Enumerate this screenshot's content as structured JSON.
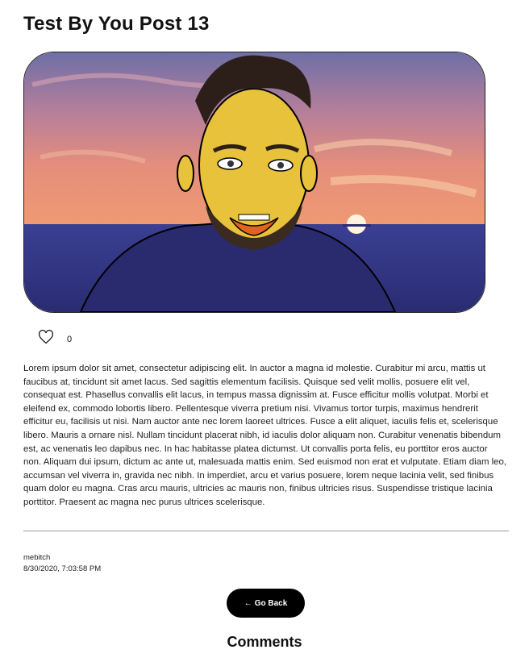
{
  "post": {
    "title": "Test By You Post 13",
    "image_alt": "Cartoon man with beard in front of a sunset over the sea",
    "like_count": "0",
    "body": "Lorem ipsum dolor sit amet, consectetur adipiscing elit. In auctor a magna id molestie. Curabitur mi arcu, mattis ut faucibus at, tincidunt sit amet lacus. Sed sagittis elementum facilisis. Quisque sed velit mollis, posuere elit vel, consequat est. Phasellus convallis elit lacus, in tempus massa dignissim at. Fusce efficitur mollis volutpat. Morbi et eleifend ex, commodo lobortis libero. Pellentesque viverra pretium nisi. Vivamus tortor turpis, maximus hendrerit efficitur eu, facilisis ut nisi. Nam auctor ante nec lorem laoreet ultrices. Fusce a elit aliquet, iaculis felis et, scelerisque libero. Mauris a ornare nisl. Nullam tincidunt placerat nibh, id iaculis dolor aliquam non. Curabitur venenatis bibendum est, ac venenatis leo dapibus nec. In hac habitasse platea dictumst. Ut convallis porta felis, eu porttitor eros auctor non. Aliquam dui ipsum, dictum ac ante ut, malesuada mattis enim. Sed euismod non erat et vulputate. Etiam diam leo, accumsan vel viverra in, gravida nec nibh. In imperdiet, arcu et varius posuere, lorem neque lacinia velit, sed finibus quam dolor eu magna. Cras arcu mauris, ultricies ac mauris non, finibus ultricies risus. Suspendisse tristique lacinia porttitor. Praesent ac magna nec purus ultrices scelerisque.",
    "author": "mebitch",
    "timestamp": "8/30/2020, 7:03:58 PM"
  },
  "actions": {
    "back_arrow": "←",
    "back_label": "Go Back"
  },
  "comments": {
    "heading": "Comments"
  },
  "icons": {
    "like": "heart-icon"
  },
  "colors": {
    "button_bg": "#000000",
    "button_text": "#ffffff",
    "divider": "#999999"
  }
}
